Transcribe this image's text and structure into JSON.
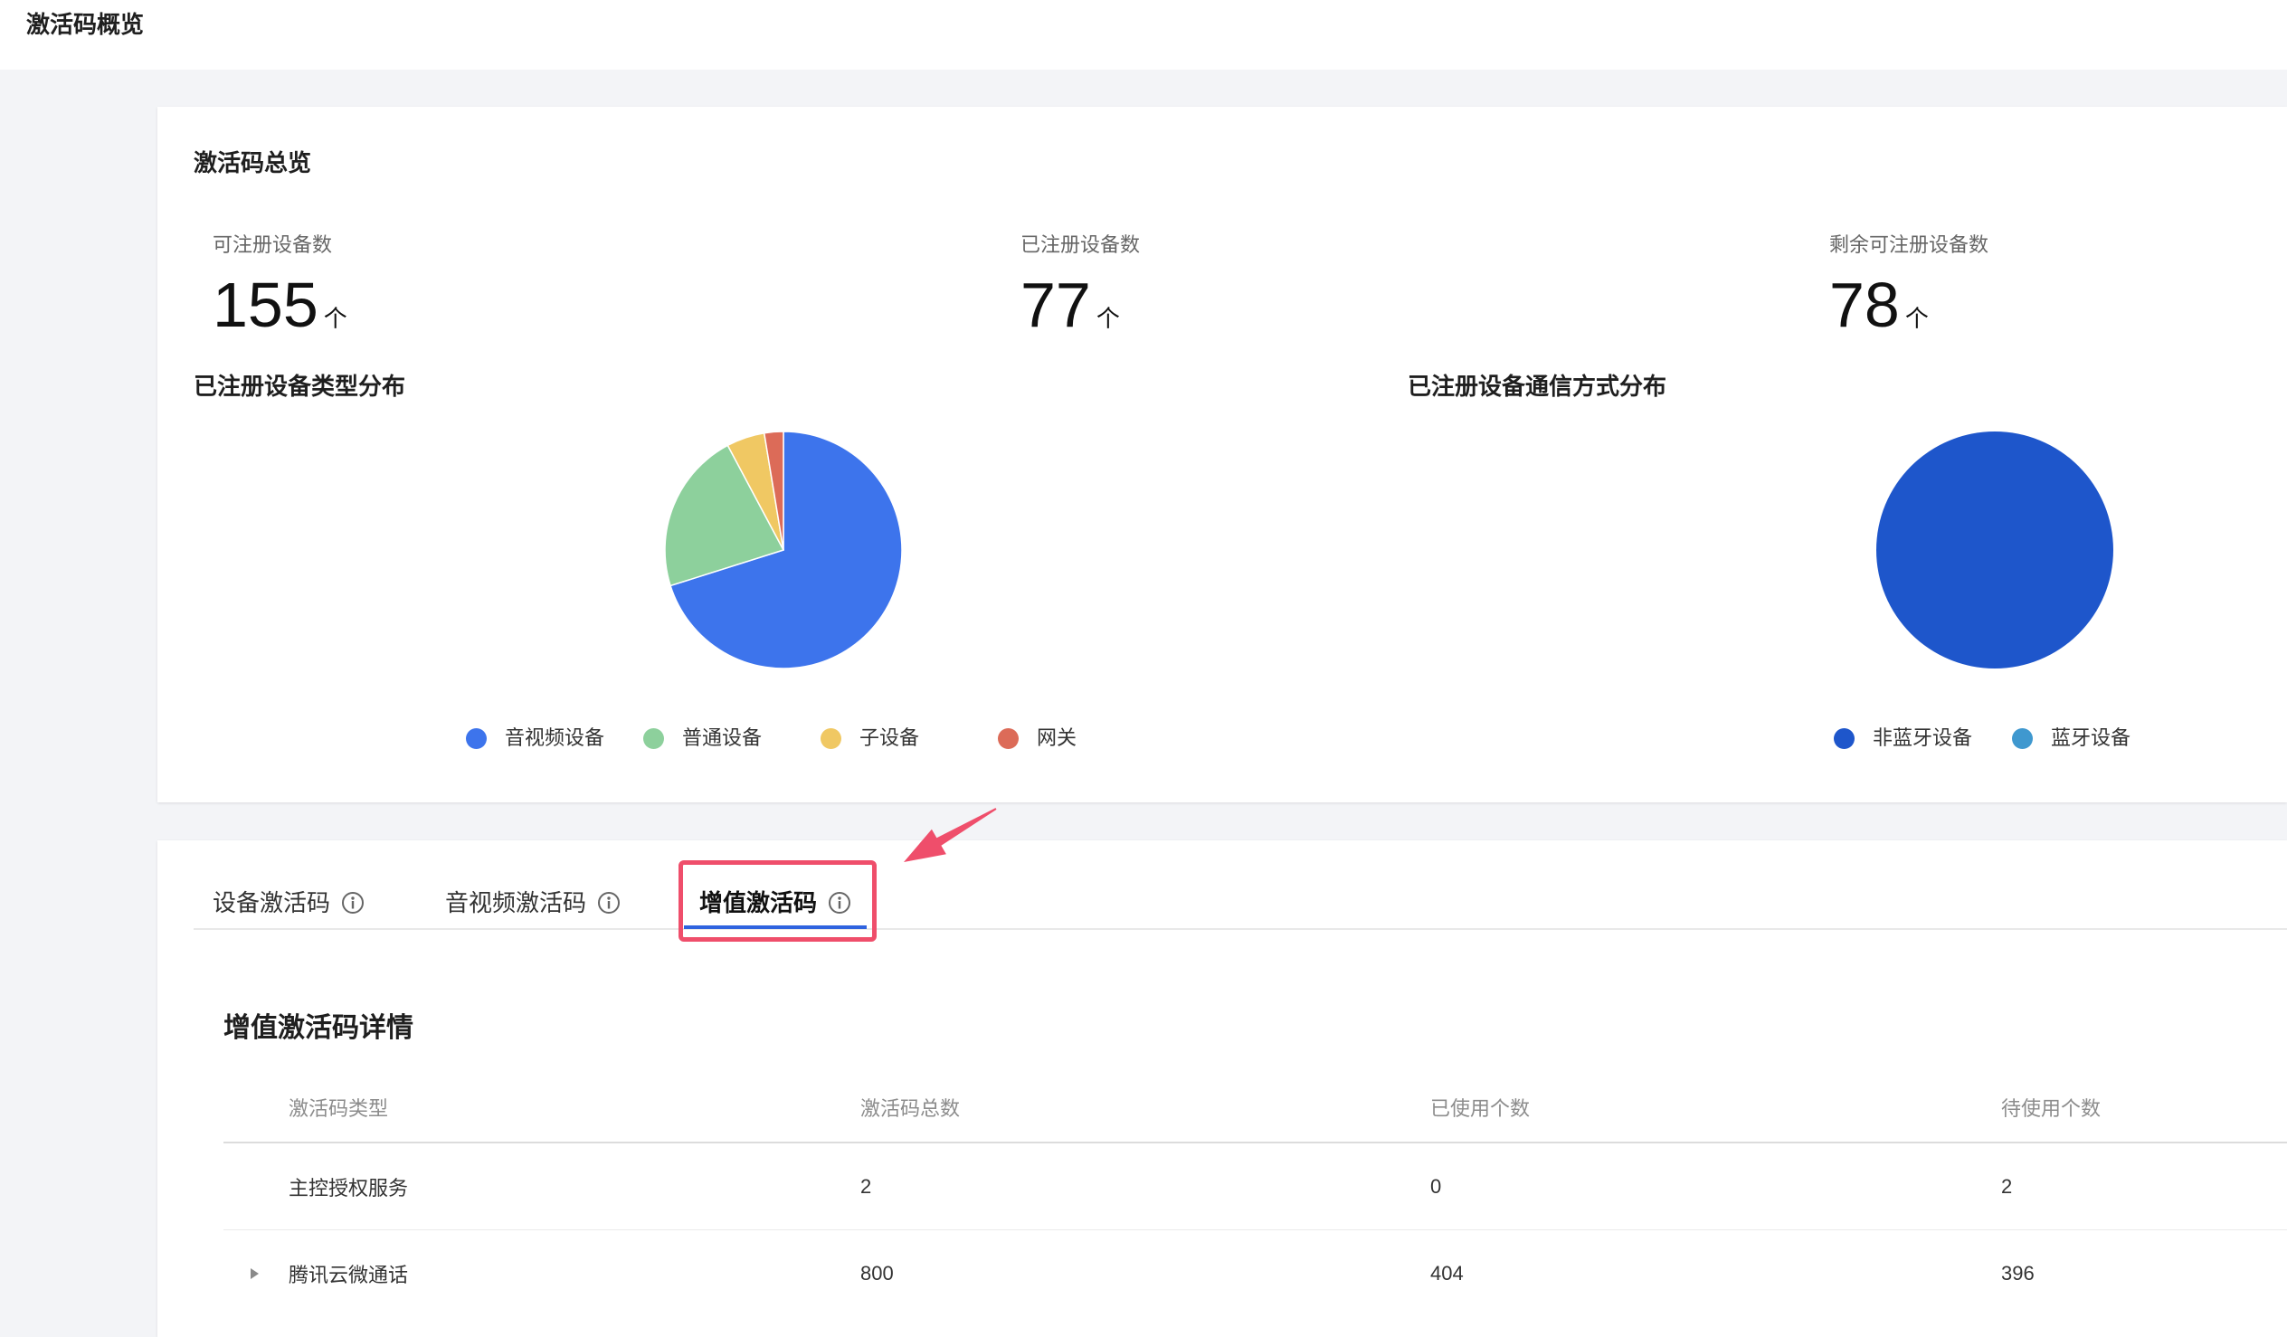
{
  "header": {
    "title": "激活码概览"
  },
  "overview": {
    "title": "激活码总览",
    "stats": [
      {
        "label": "可注册设备数",
        "value": "155",
        "unit": "个"
      },
      {
        "label": "已注册设备数",
        "value": "77",
        "unit": "个"
      },
      {
        "label": "剩余可注册设备数",
        "value": "78",
        "unit": "个"
      }
    ]
  },
  "chart_data": [
    {
      "type": "pie",
      "title": "已注册设备类型分布",
      "categories": [
        "音视频设备",
        "普通设备",
        "子设备",
        "网关"
      ],
      "values": [
        54,
        17,
        4,
        2
      ],
      "colors": [
        "#3d74ec",
        "#8dd09c",
        "#f0c863",
        "#dc6b58"
      ],
      "legend": "bottom"
    },
    {
      "type": "pie",
      "title": "已注册设备通信方式分布",
      "categories": [
        "非蓝牙设备",
        "蓝牙设备"
      ],
      "values": [
        77,
        0
      ],
      "colors": [
        "#1e56cb",
        "#3f98cf"
      ],
      "legend": "bottom"
    }
  ],
  "tabs": [
    {
      "label": "设备激活码",
      "icon": "info-icon",
      "active": false
    },
    {
      "label": "音视频激活码",
      "icon": "info-icon",
      "active": false
    },
    {
      "label": "增值激活码",
      "icon": "info-icon",
      "active": true
    }
  ],
  "detail": {
    "title": "增值激活码详情",
    "columns": [
      "激活码类型",
      "激活码总数",
      "已使用个数",
      "待使用个数"
    ],
    "expand_icon": "caret-right-icon",
    "rows": [
      {
        "cells": [
          "主控授权服务",
          "2",
          "0",
          "2"
        ],
        "expandable": false
      },
      {
        "cells": [
          "腾讯云微通话",
          "800",
          "404",
          "396"
        ],
        "expandable": true
      }
    ]
  },
  "colors": {
    "page_background": "#f3f4f7",
    "accent": "#2f63df",
    "annotation": "#ef4e6b"
  }
}
